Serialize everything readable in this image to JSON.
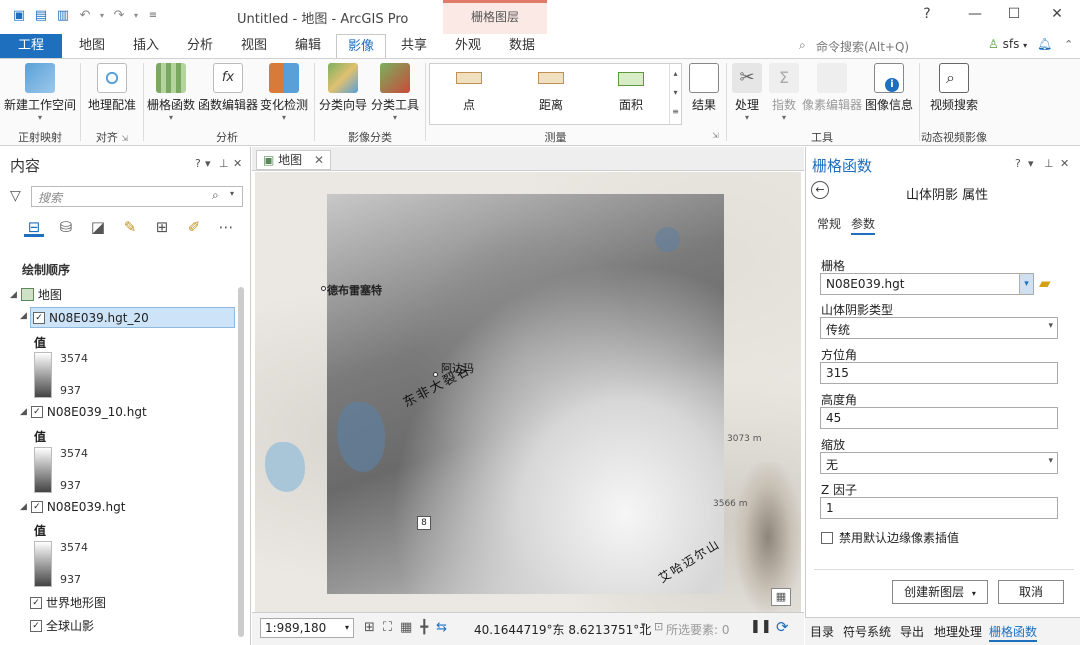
{
  "window": {
    "title": "Untitled - 地图 - ArcGIS Pro",
    "context_tab_group": "栅格图层",
    "help": "?",
    "minimize": "—",
    "maximize": "☐",
    "close": "✕"
  },
  "ribbon_tabs": {
    "file": "工程",
    "map": "地图",
    "insert": "插入",
    "analysis": "分析",
    "view": "视图",
    "edit": "编辑",
    "imagery": "影像",
    "share": "共享",
    "appearance": "外观",
    "data": "数据"
  },
  "command_search": {
    "placeholder": "命令搜索(Alt+Q)"
  },
  "user": {
    "name": "sfs"
  },
  "ribbon": {
    "ortho": {
      "new_workspace": "新建工作空间",
      "group": "正射映射"
    },
    "align": {
      "georeference": "地理配准",
      "group": "对齐"
    },
    "analysis": {
      "raster_functions": "栅格函数",
      "function_editor": "函数编辑器",
      "change_detection": "变化检测",
      "group": "分析"
    },
    "classification": {
      "classify_wizard": "分类向导",
      "classify_tools": "分类工具",
      "group": "影像分类"
    },
    "measure": {
      "point": "点",
      "distance": "距离",
      "area": "面积",
      "group": "测量"
    },
    "results": "结果",
    "tools": {
      "process": "处理",
      "indices": "指数",
      "pixel_editor": "像素编辑器",
      "image_info": "图像信息",
      "group": "工具"
    },
    "motion": {
      "video_search": "视频搜索",
      "group": "动态视频影像"
    }
  },
  "contents": {
    "title": "内容",
    "search_placeholder": "搜索",
    "drawing_order": "绘制顺序",
    "map_name": "地图",
    "layers": [
      {
        "name": "N08E039.hgt_20",
        "value_label": "值",
        "high": "3574",
        "low": "937"
      },
      {
        "name": "N08E039_10.hgt",
        "value_label": "值",
        "high": "3574",
        "low": "937"
      },
      {
        "name": "N08E039.hgt",
        "value_label": "值",
        "high": "3574",
        "low": "937"
      }
    ],
    "basemaps": [
      "世界地形图",
      "全球山影"
    ]
  },
  "map": {
    "tab_label": "地图",
    "labels": {
      "town1": "德布雷塞特",
      "town2": "阿达玛",
      "rift": "东非大裂谷",
      "mountain": "艾哈迈尔山",
      "road": "8",
      "elev1": "3073 m",
      "elev2": "3566 m"
    },
    "scale": "1:989,180",
    "coordinates": "40.1644719°东 8.6213751°北",
    "selected_features": "所选要素: 0"
  },
  "raster_function_pane": {
    "title": "栅格函数",
    "subtitle": "山体阴影 属性",
    "tabs": {
      "general": "常规",
      "parameters": "参数"
    },
    "fields": {
      "raster": {
        "label": "栅格",
        "value": "N08E039.hgt"
      },
      "hillshade_type": {
        "label": "山体阴影类型",
        "value": "传统"
      },
      "azimuth": {
        "label": "方位角",
        "value": "315"
      },
      "altitude": {
        "label": "高度角",
        "value": "45"
      },
      "scaling": {
        "label": "缩放",
        "value": "无"
      },
      "z_factor": {
        "label": "Z 因子",
        "value": "1"
      }
    },
    "disable_edge_interp": "禁用默认边缘像素插值",
    "create_layer": "创建新图层",
    "cancel": "取消"
  },
  "bottom_tabs": {
    "catalog": "目录",
    "symbology": "符号系统",
    "export": "导出",
    "geoprocessing": "地理处理",
    "raster_functions": "栅格函数"
  },
  "colors": {
    "accent": "#1f6fbf",
    "context_tab": "#fbe9e6"
  }
}
